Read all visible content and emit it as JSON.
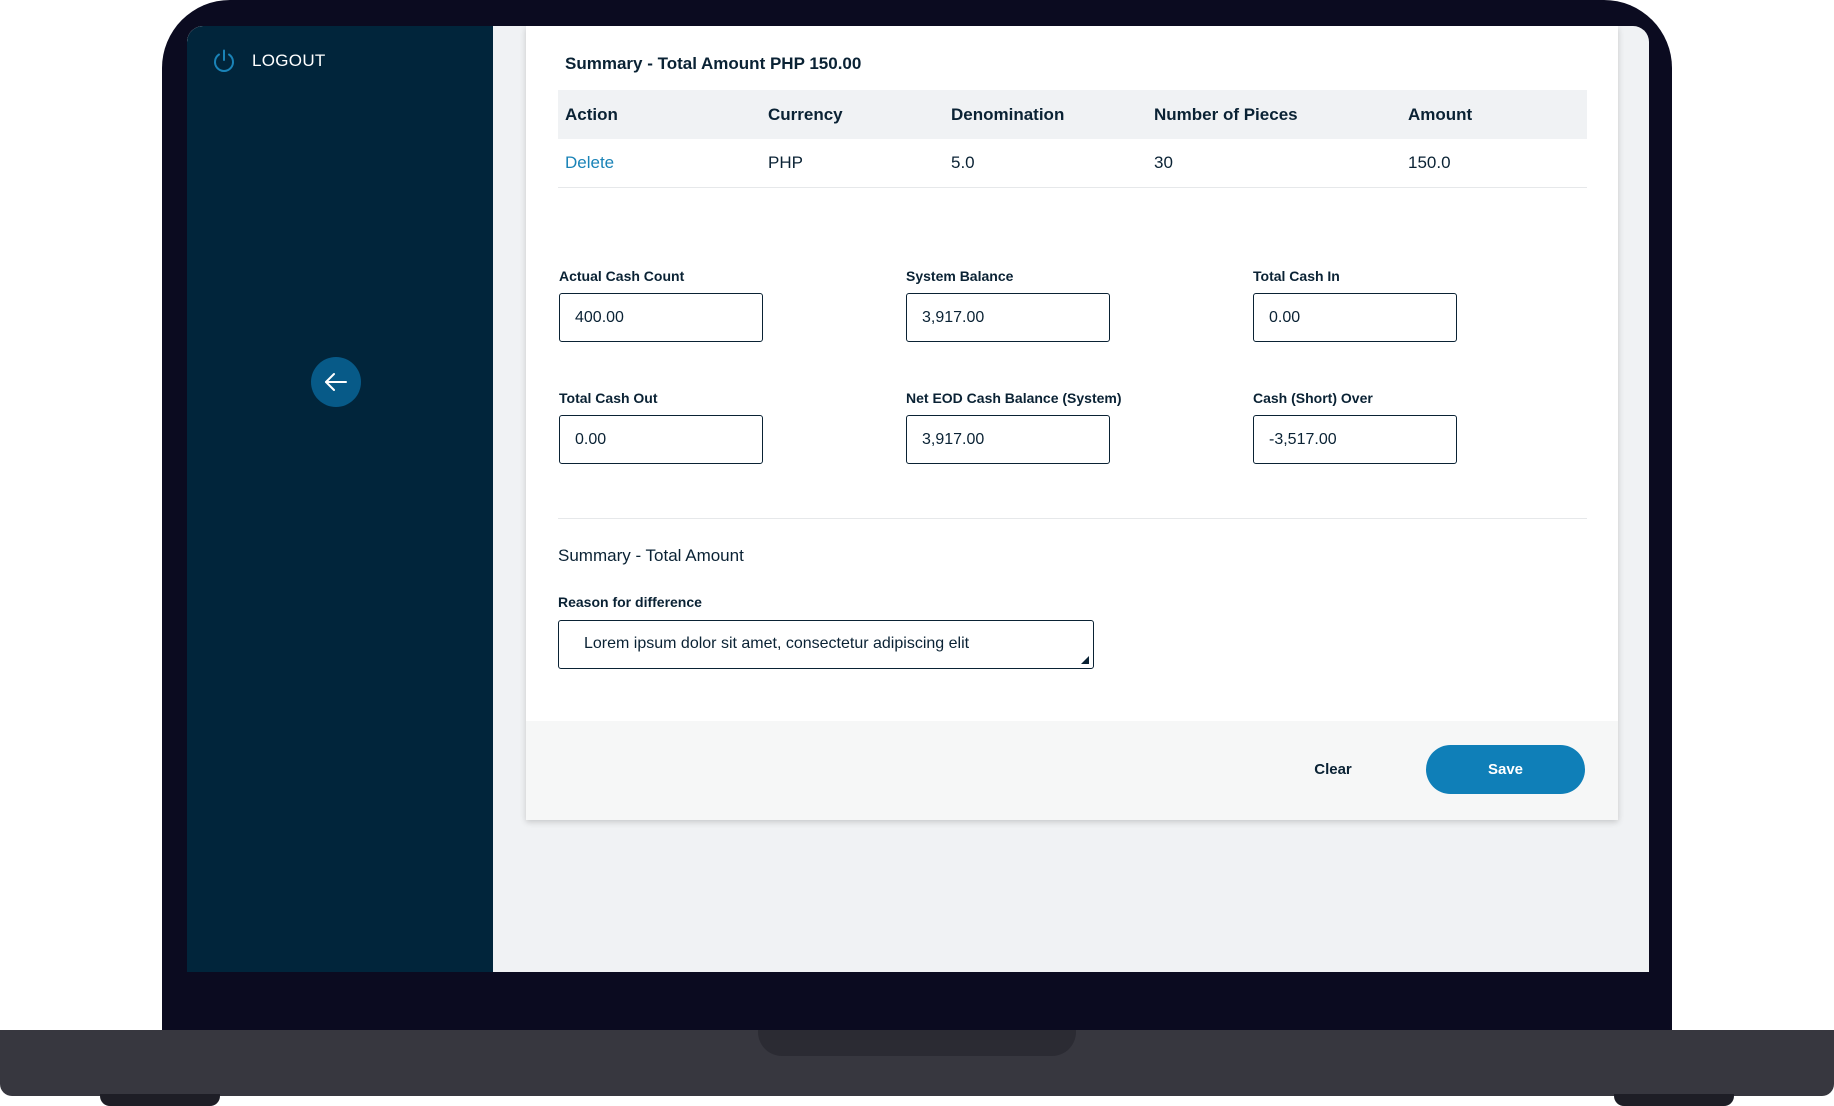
{
  "sidebar": {
    "logout_label": "LOGOUT",
    "back_icon": "arrow-left-icon",
    "logout_icon": "power-icon"
  },
  "summary": {
    "title": "Summary - Total Amount PHP 150.00",
    "columns": [
      "Action",
      "Currency",
      "Denomination",
      "Number of Pieces",
      "Amount"
    ],
    "rows": [
      {
        "action": "Delete",
        "currency": "PHP",
        "denomination": "5.0",
        "pieces": "30",
        "amount": "150.0"
      }
    ]
  },
  "fields": {
    "actual_cash_count": {
      "label": "Actual Cash Count",
      "value": "400.00"
    },
    "system_balance": {
      "label": "System Balance",
      "value": "3,917.00"
    },
    "total_cash_in": {
      "label": "Total Cash In",
      "value": "0.00"
    },
    "total_cash_out": {
      "label": "Total Cash Out",
      "value": "0.00"
    },
    "net_eod_balance": {
      "label": "Net EOD Cash Balance  (System)",
      "value": "3,917.00"
    },
    "cash_short_over": {
      "label": "Cash (Short) Over",
      "value": "-3,517.00"
    }
  },
  "reason": {
    "section_title": "Summary - Total Amount",
    "label": "Reason for difference",
    "value": "Lorem ipsum dolor sit amet, consectetur adipiscing elit"
  },
  "actions": {
    "clear_label": "Clear",
    "save_label": "Save"
  },
  "colors": {
    "sidebar": "#01253b",
    "primary": "#0f7fb8",
    "link": "#1a83b7",
    "text": "#0a2234"
  }
}
